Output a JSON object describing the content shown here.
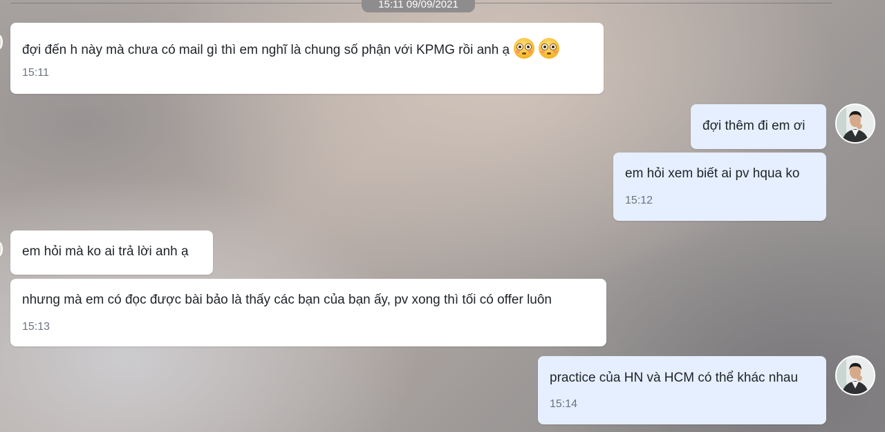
{
  "date_separator": "15:11 09/09/2021",
  "messages": [
    {
      "text": "đợi đến h này mà chưa có mail gì thì em nghĩ là chung số phận với KPMG rồi anh ạ",
      "time": "15:11",
      "emoji": "flushed-face-icon",
      "direction": "incoming"
    },
    {
      "text": "đợi thêm đi em ơi",
      "time": "",
      "direction": "outgoing"
    },
    {
      "text": "em hỏi xem biết ai pv hqua ko",
      "time": "15:12",
      "direction": "outgoing"
    },
    {
      "text": "em hỏi mà ko ai trả lời anh ạ",
      "time": "",
      "direction": "incoming"
    },
    {
      "text": "nhưng mà em có đọc được bài bảo là thấy các bạn của bạn ấy, pv xong thì tối có offer luôn",
      "time": "15:13",
      "direction": "incoming"
    },
    {
      "text": "practice của HN và HCM có thể khác nhau",
      "time": "15:14",
      "direction": "outgoing"
    }
  ],
  "colors": {
    "incoming_bubble": "#ffffff",
    "outgoing_bubble": "#e5efff",
    "date_pill": "#8f8c8d",
    "timestamp": "#6b7380"
  }
}
